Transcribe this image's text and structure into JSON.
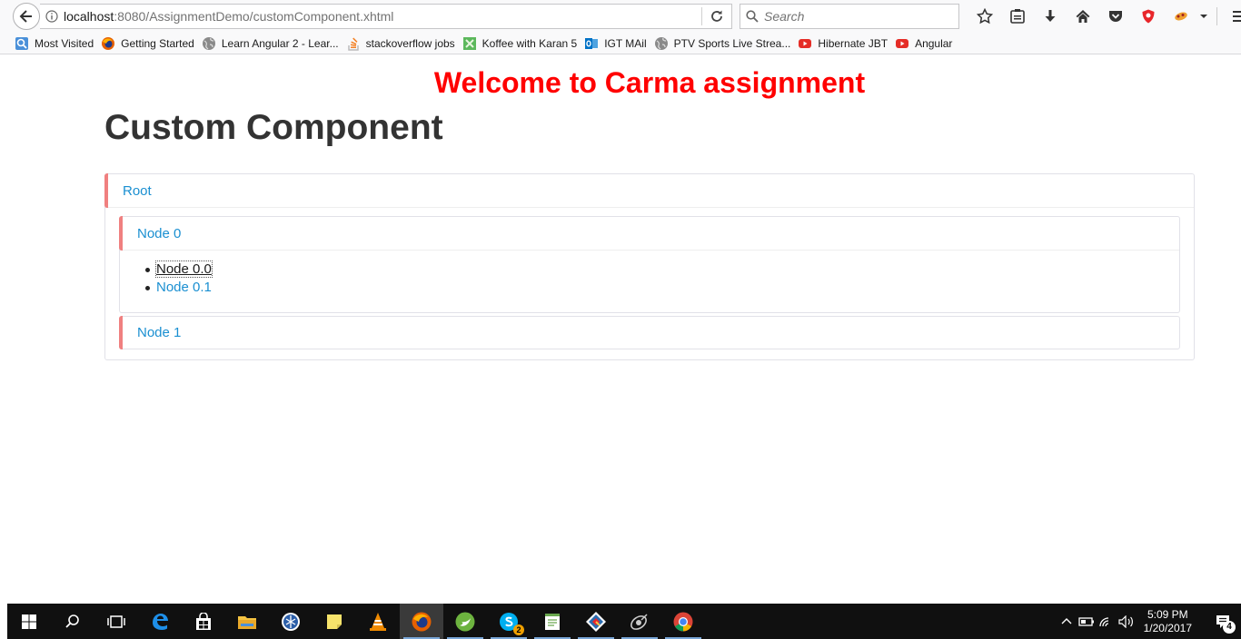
{
  "browser": {
    "url_host": "localhost",
    "url_rest": ":8080/AssignmentDemo/customComponent.xhtml",
    "search_placeholder": "Search",
    "toolbar_icons": [
      "star-icon",
      "reading-list-icon",
      "download-icon",
      "home-icon",
      "pocket-icon",
      "shield-icon",
      "extension-icon",
      "chevron-down-icon",
      "menu-icon"
    ]
  },
  "bookmarks": [
    {
      "label": "Most Visited",
      "icon": "most-visited-icon",
      "color": "#4a90d9"
    },
    {
      "label": "Getting Started",
      "icon": "firefox-icon",
      "color": "#e66000"
    },
    {
      "label": "Learn Angular 2 - Lear...",
      "icon": "globe-icon",
      "color": "#8a8a8a"
    },
    {
      "label": "stackoverflow jobs",
      "icon": "stackoverflow-icon",
      "color": "#f48024"
    },
    {
      "label": "Koffee with Karan 5",
      "icon": "koffee-icon",
      "color": "#5cb85c"
    },
    {
      "label": "IGT MAil",
      "icon": "outlook-icon",
      "color": "#0072c6"
    },
    {
      "label": "PTV Sports Live Strea...",
      "icon": "globe-icon",
      "color": "#8a8a8a"
    },
    {
      "label": "Hibernate JBT",
      "icon": "youtube-icon",
      "color": "#e52d27"
    },
    {
      "label": "Angular",
      "icon": "youtube-icon",
      "color": "#e52d27"
    }
  ],
  "page": {
    "welcome": "Welcome to Carma assignment",
    "title": "Custom Component"
  },
  "tree": {
    "root": "Root",
    "node0": "Node 0",
    "node0_children": [
      "Node 0.0",
      "Node 0.1"
    ],
    "node1": "Node 1"
  },
  "taskbar": {
    "apps": [
      "start-icon",
      "search-icon",
      "task-view-icon",
      "edge-icon",
      "store-icon",
      "file-explorer-icon",
      "app-icon",
      "sticky-notes-icon",
      "vlc-icon",
      "firefox-icon",
      "spring-icon",
      "skype-icon",
      "notepad-icon",
      "git-icon",
      "satellite-icon",
      "chrome-icon"
    ],
    "skype_badge": "2",
    "time": "5:09 PM",
    "date": "1/20/2017",
    "notification_count": "4"
  },
  "colors": {
    "welcome": "#ff0000",
    "link": "#1a8fd1",
    "panel_accent": "#f08080"
  }
}
